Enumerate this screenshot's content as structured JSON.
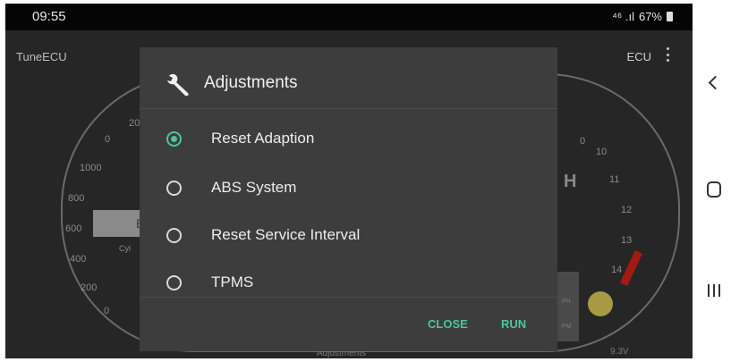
{
  "status_bar": {
    "time": "09:55",
    "signal": "⁴⁶ .ıl",
    "battery": "67%"
  },
  "app_bar": {
    "title": "TuneECU",
    "ecu_label": "ECU"
  },
  "dashboard": {
    "left_gauge_ticks": [
      "20",
      "0",
      "1000",
      "800",
      "600",
      "400",
      "200",
      "0"
    ],
    "right_gauge_ticks": [
      "0",
      "10",
      "11",
      "12",
      "13",
      "14"
    ],
    "left_small_label": "Cyl",
    "center_letter": "H",
    "left_box_text": "E",
    "right_edge_labels": [
      "PH",
      "PM"
    ],
    "bottom_label": "Adjustments",
    "voltage": "9.3V"
  },
  "dialog": {
    "title": "Adjustments",
    "options": [
      {
        "label": "Reset Adaption",
        "checked": true
      },
      {
        "label": "ABS System",
        "checked": false
      },
      {
        "label": "Reset Service Interval",
        "checked": false
      },
      {
        "label": "TPMS",
        "checked": false
      }
    ],
    "close_label": "CLOSE",
    "run_label": "RUN"
  },
  "colors": {
    "accent": "#4fc3a1",
    "dialog_bg": "#3d3d3d",
    "screen_bg": "#262626"
  }
}
